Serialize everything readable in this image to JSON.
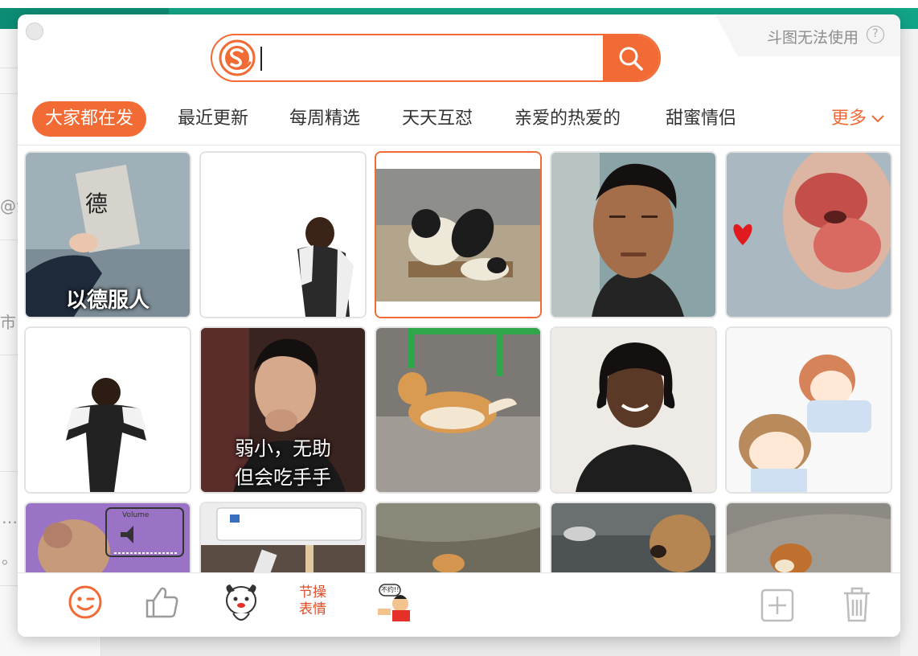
{
  "background": {
    "left_fragments": [
      "@海",
      "市",
      "…",
      "。"
    ]
  },
  "panel": {
    "corner_notice": "斗图无法使用",
    "help_icon": "question-icon"
  },
  "search": {
    "logo": "sogou-logo",
    "placeholder": "",
    "value": "",
    "button_icon": "search-icon"
  },
  "tabs": [
    {
      "label": "大家都在发",
      "active": true
    },
    {
      "label": "最近更新",
      "active": false
    },
    {
      "label": "每周精选",
      "active": false
    },
    {
      "label": "天天互怼",
      "active": false
    },
    {
      "label": "亲爱的热爱的",
      "active": false
    },
    {
      "label": "甜蜜情侣",
      "active": false
    }
  ],
  "more_label": "更多",
  "grid": {
    "items": [
      {
        "caption": "以德服人",
        "sign": "德"
      },
      {
        "caption": ""
      },
      {
        "caption": "",
        "selected": true
      },
      {
        "caption": ""
      },
      {
        "caption": ""
      },
      {
        "caption": ""
      },
      {
        "caption_line1": "弱小，无助",
        "caption_line2": "但会吃手手"
      },
      {
        "caption": ""
      },
      {
        "caption": ""
      },
      {
        "caption": ""
      },
      {
        "caption": "",
        "overlay": "Volume"
      },
      {
        "caption": ""
      },
      {
        "caption": ""
      },
      {
        "caption": ""
      },
      {
        "caption": ""
      }
    ]
  },
  "footer": {
    "emoji_icon": "wink-face-icon",
    "like_icon": "thumbs-up-icon",
    "mascot": "dog-mascot-icon",
    "jiecao_line1": "节操",
    "jiecao_line2": "表情",
    "sticker_text": "不约!!",
    "add_icon": "add-square-icon",
    "trash_icon": "trash-icon"
  },
  "colors": {
    "accent": "#f26a34",
    "teal": "#12a487"
  }
}
